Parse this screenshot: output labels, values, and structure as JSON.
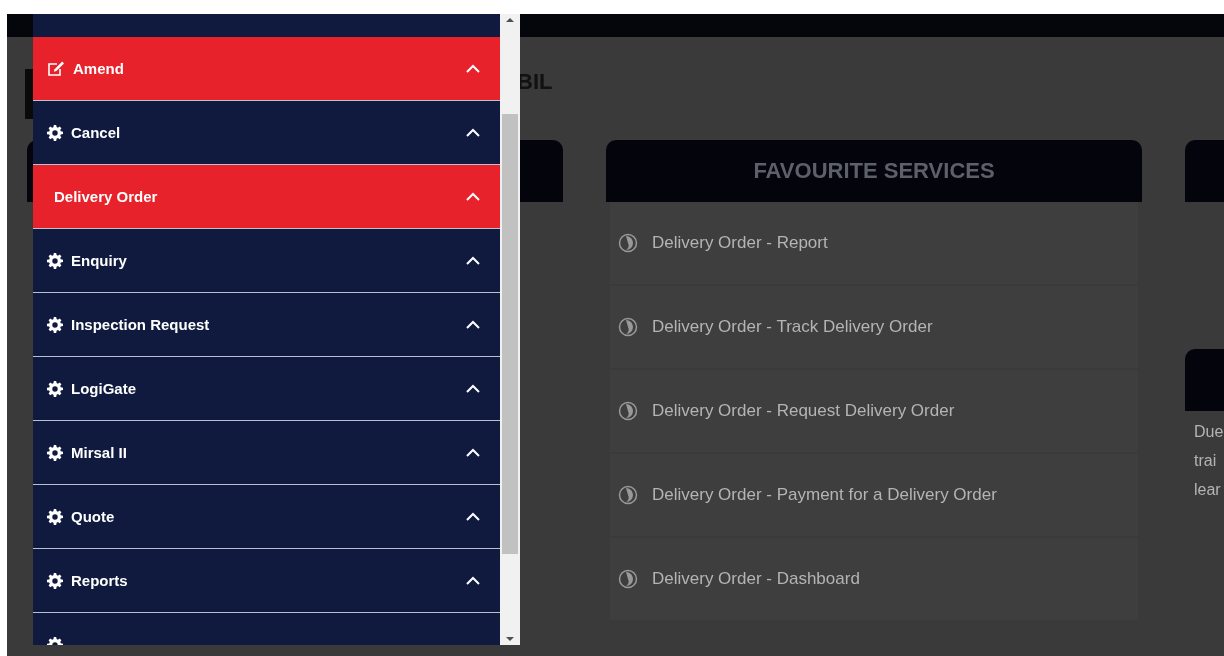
{
  "page_title": "BIL",
  "menu": {
    "items": [
      {
        "label": "Amend",
        "kind": "edit",
        "selected": true
      },
      {
        "label": "Cancel",
        "kind": "gear",
        "selected": false
      },
      {
        "label": "Delivery Order",
        "kind": "plain",
        "selected": true
      },
      {
        "label": "Enquiry",
        "kind": "gear",
        "selected": false
      },
      {
        "label": "Inspection Request",
        "kind": "gear",
        "selected": false
      },
      {
        "label": "LogiGate",
        "kind": "gear",
        "selected": false
      },
      {
        "label": "Mirsal II",
        "kind": "gear",
        "selected": false
      },
      {
        "label": "Quote",
        "kind": "gear",
        "selected": false
      },
      {
        "label": "Reports",
        "kind": "gear",
        "selected": false
      },
      {
        "kind": "partial",
        "selected": false
      }
    ]
  },
  "favourite_services": {
    "title": "FAVOURITE SERVICES",
    "items": [
      "Delivery Order - Report",
      "Delivery Order - Track Delivery Order",
      "Delivery Order - Request Delivery Order",
      "Delivery Order - Payment for a Delivery Order",
      "Delivery Order - Dashboard"
    ]
  },
  "right_card": {
    "lines": [
      "Due",
      "trai",
      "lear"
    ]
  }
}
